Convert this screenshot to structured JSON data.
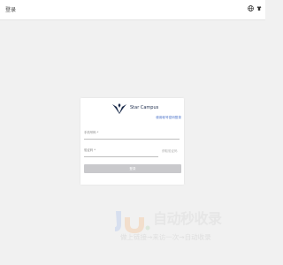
{
  "header": {
    "title": "登录",
    "icons": [
      "globe-icon",
      "shirt-icon"
    ]
  },
  "login": {
    "brand_name": "Star Campus",
    "switch_link": "使用帐号密码登录",
    "phone": {
      "label": "手机号码 *",
      "value": ""
    },
    "code": {
      "label": "验证码 *",
      "value": "",
      "send_label": "获取验证码"
    },
    "submit_label": "登录"
  },
  "watermark": {
    "title": "自动秒收录",
    "subtitle": "做上链接→来访一次→自动收录"
  },
  "colors": {
    "accent": "#4a72c9",
    "brand_navy": "#1a2a4a",
    "disabled_button": "#c9c9cc",
    "background": "#f1f1f1"
  }
}
